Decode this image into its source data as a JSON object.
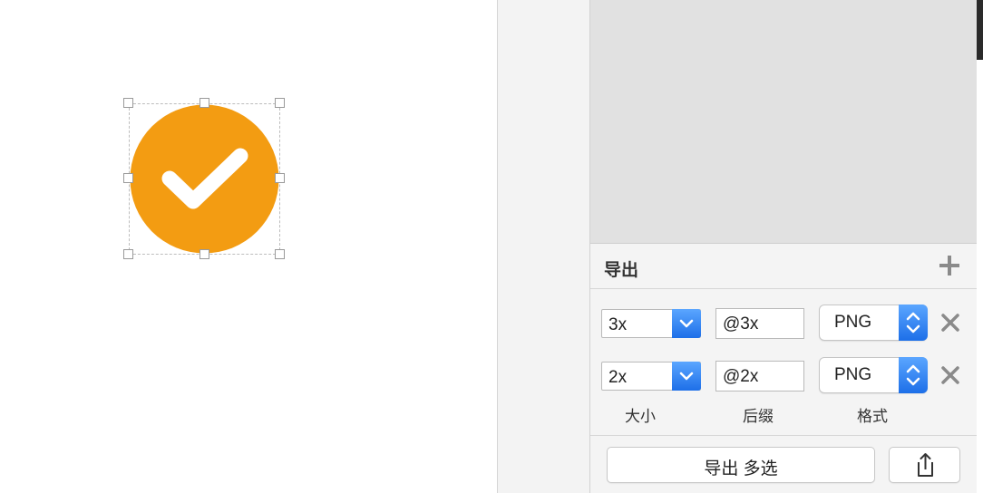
{
  "canvas": {
    "accent_color": "#f39c12",
    "icon": "checkmark-circle-icon"
  },
  "export": {
    "title": "导出",
    "add_icon": "plus-icon",
    "rows": [
      {
        "size": "3x",
        "suffix": "@3x",
        "format": "PNG"
      },
      {
        "size": "2x",
        "suffix": "@2x",
        "format": "PNG"
      }
    ],
    "labels": {
      "size": "大小",
      "suffix": "后缀",
      "format": "格式"
    },
    "export_button": "导出 多选",
    "share_icon": "share-icon",
    "remove_icon": "close-icon"
  },
  "colors": {
    "select_blue": "#1d6fe8",
    "panel_bg": "#f4f4f4",
    "preview_bg": "#e1e1e1"
  }
}
